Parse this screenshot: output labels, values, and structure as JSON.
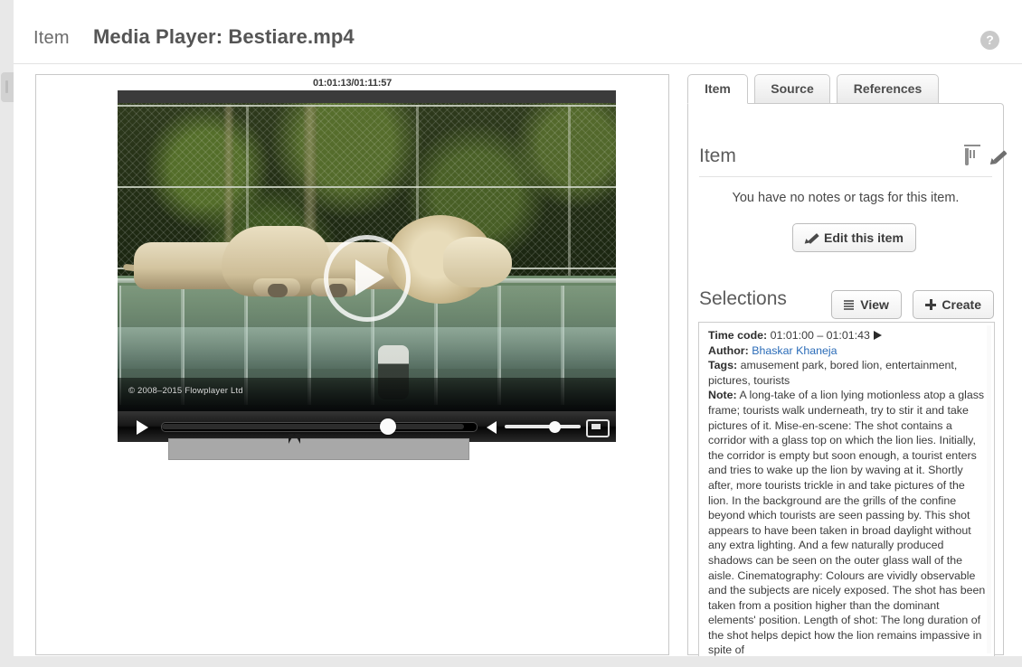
{
  "header": {
    "kicker": "Item",
    "title": "Media Player: Bestiare.mp4",
    "help_icon": "?"
  },
  "player": {
    "timecode_display": "01:01:13/01:11:57",
    "watermark": "© 2008–2015 Flowplayer Ltd",
    "controls": {
      "play_label": "play",
      "volume_label": "volume",
      "fullscreen_label": "fullscreen"
    }
  },
  "tabs": [
    {
      "label": "Item",
      "active": true
    },
    {
      "label": "Source",
      "active": false
    },
    {
      "label": "References",
      "active": false
    }
  ],
  "item_section": {
    "heading": "Item",
    "empty_message": "You have no notes or tags for this item.",
    "edit_button": "Edit this item"
  },
  "selections_section": {
    "heading": "Selections",
    "view_button": "View",
    "create_button": "Create",
    "entry": {
      "time_code_label": "Time code:",
      "time_code_value": "01:01:00 – 01:01:43",
      "author_label": "Author:",
      "author_value": "Bhaskar Khaneja",
      "tags_label": "Tags:",
      "tags_value": "amusement park, bored lion, entertainment, pictures, tourists",
      "note_label": "Note:",
      "note_value": "A long-take of a lion lying motionless atop a glass frame; tourists walk underneath, try to stir it and take pictures of it. Mise-en-scene: The shot contains a corridor with a glass top on which the lion lies. Initially, the corridor is empty but soon enough, a tourist enters and tries to wake up the lion by waving at it. Shortly after, more tourists trickle in and take pictures of the lion. In the background are the grills of the confine beyond which tourists are seen passing by. This shot appears to have been taken in broad daylight without any extra lighting. And a few naturally produced shadows can be seen on the outer glass wall of the aisle. Cinematography: Colours are vividly observable and the subjects are nicely exposed. The shot has been taken from a position higher than the dominant elements' position. Length of shot: The long duration of the shot helps depict how the lion remains impassive in spite of"
    }
  },
  "colors": {
    "page_background": "#e8e8e8",
    "panel_border": "#c9c9c9",
    "title_text": "#555555",
    "link": "#2b6cb8",
    "button_face": "#f0f0f0"
  }
}
